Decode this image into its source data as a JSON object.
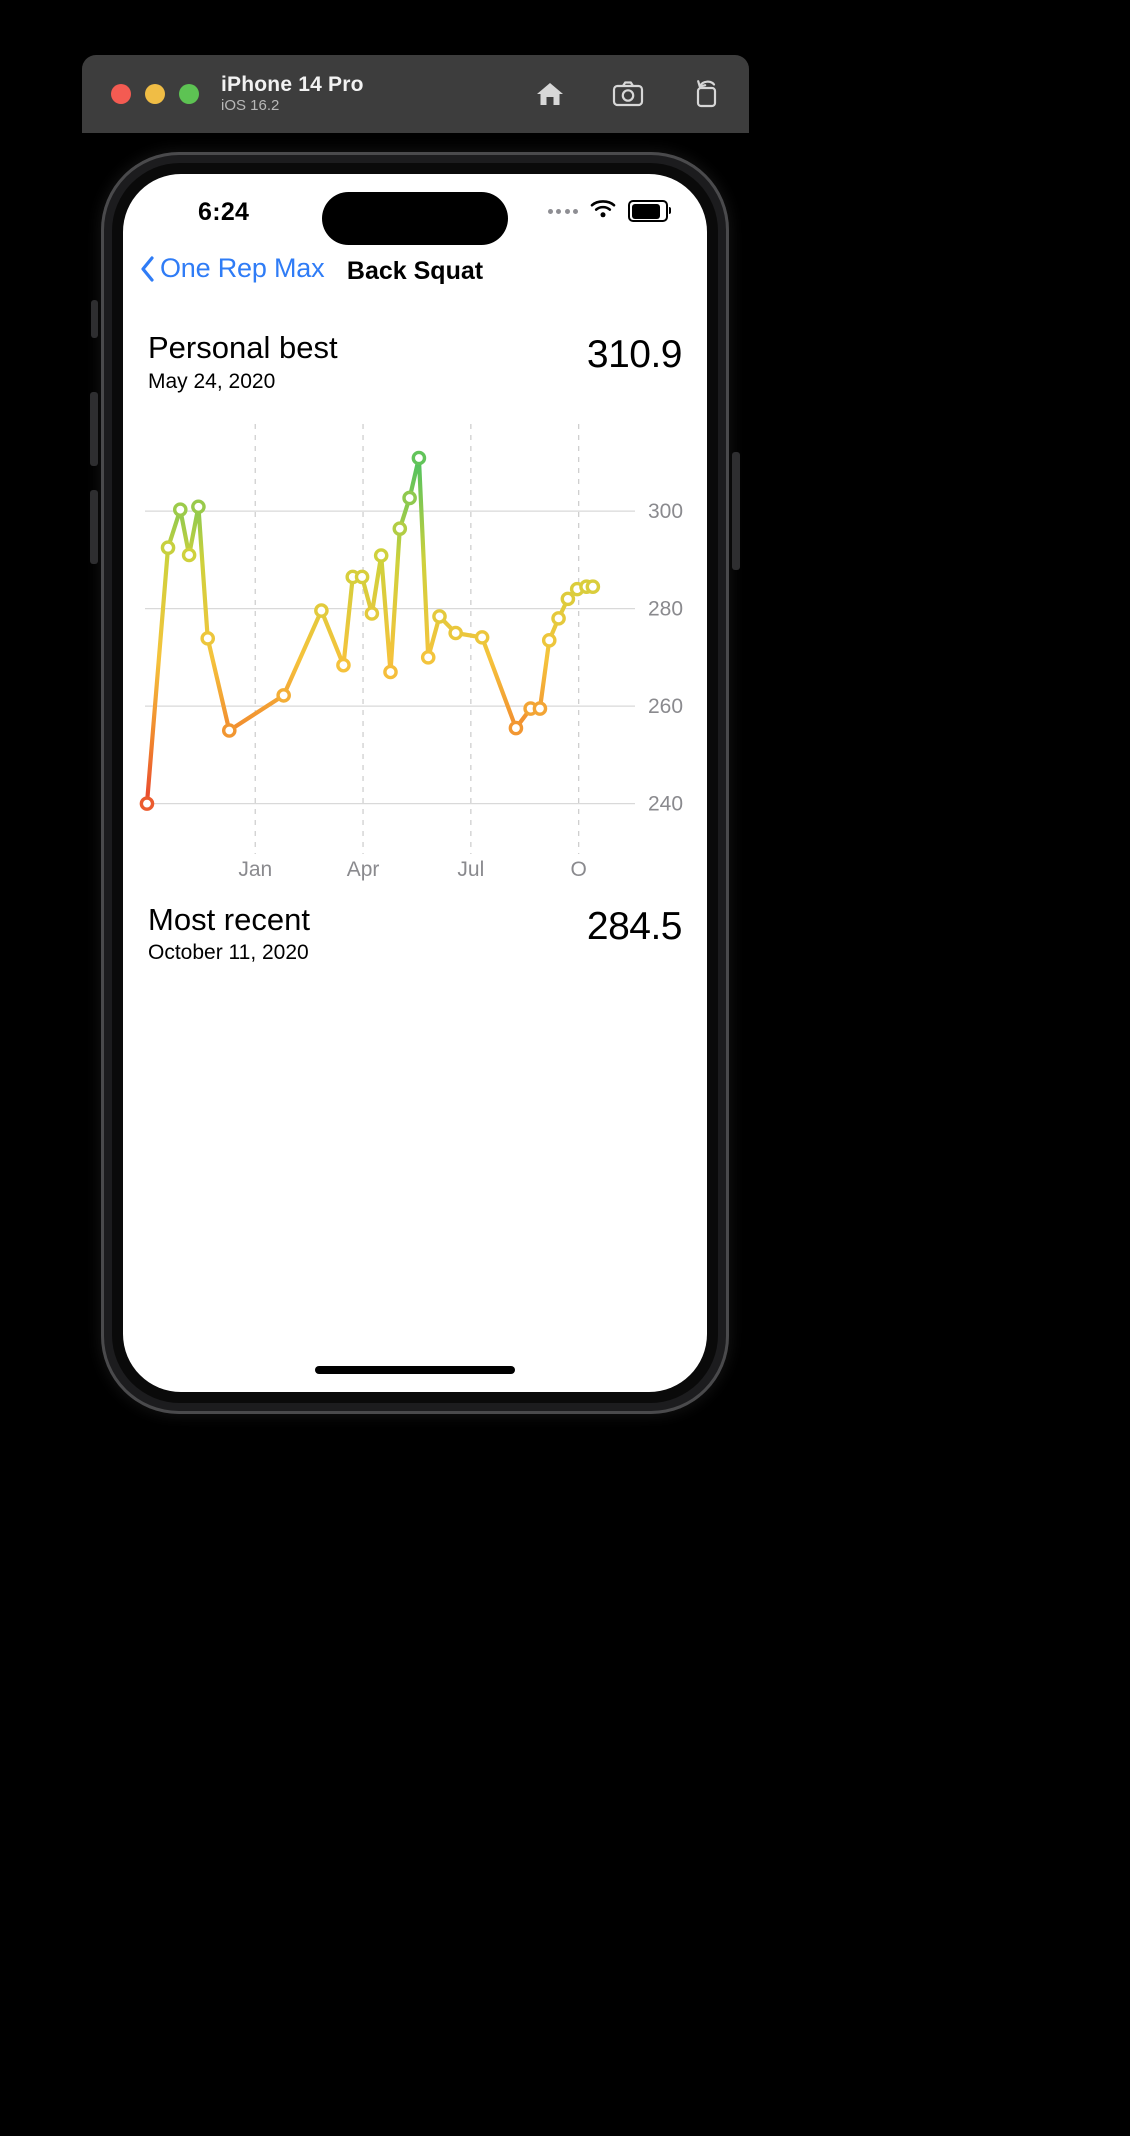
{
  "window": {
    "title": "iPhone 14 Pro",
    "subtitle": "iOS 16.2",
    "traffic_lights": [
      "close-red",
      "minimize-yellow",
      "zoom-green"
    ],
    "actions": [
      {
        "name": "home-icon",
        "label": "Home"
      },
      {
        "name": "screenshot-icon",
        "label": "Screenshot"
      },
      {
        "name": "rotate-icon",
        "label": "Rotate"
      }
    ],
    "colors": {
      "chrome": "#3d3d3d",
      "red": "#f45b52",
      "yellow": "#f0bd45",
      "green": "#5dc353"
    }
  },
  "status_bar": {
    "time": "6:24",
    "cellular": "cellular-dots-icon",
    "wifi": "wifi-icon",
    "battery": "battery-icon"
  },
  "nav": {
    "back_label": "One Rep Max",
    "title": "Back Squat",
    "accent": "#2f7cf6"
  },
  "personal_best": {
    "title": "Personal best",
    "date": "May 24, 2020",
    "value": "310.9"
  },
  "most_recent": {
    "title": "Most recent",
    "date": "October 11, 2020",
    "value": "284.5"
  },
  "chart_data": {
    "type": "line",
    "title": "",
    "xlabel": "",
    "ylabel": "",
    "ylim": [
      235,
      315
    ],
    "yticks": [
      240,
      260,
      280,
      300
    ],
    "ytick_labels": [
      "240",
      "260",
      "280",
      "300"
    ],
    "xtick_labels": [
      "Jan",
      "Apr",
      "Jul",
      "O"
    ],
    "xtick_positions": [
      0.225,
      0.445,
      0.665,
      0.885
    ],
    "grid": "horizontal-solid-and-vertical-dashed",
    "gradient_stops": [
      {
        "offset": 0.0,
        "color": "#e8452f"
      },
      {
        "offset": 0.18,
        "color": "#f0832d"
      },
      {
        "offset": 0.42,
        "color": "#f5c33c"
      },
      {
        "offset": 0.7,
        "color": "#cfd13c"
      },
      {
        "offset": 1.0,
        "color": "#4cc160"
      }
    ],
    "marker": "open-circle",
    "series": [
      {
        "name": "One Rep Max",
        "x": [
          0.004,
          0.047,
          0.072,
          0.09,
          0.109,
          0.128,
          0.172,
          0.283,
          0.36,
          0.405,
          0.424,
          0.443,
          0.463,
          0.482,
          0.501,
          0.52,
          0.54,
          0.559,
          0.578,
          0.601,
          0.634,
          0.688,
          0.757,
          0.787,
          0.806,
          0.825,
          0.844,
          0.863,
          0.882,
          0.901,
          0.914
        ],
        "y": [
          240.0,
          292.5,
          300.3,
          291.0,
          300.9,
          273.9,
          255.0,
          262.2,
          279.6,
          268.4,
          286.5,
          286.5,
          279.0,
          290.9,
          267.0,
          296.4,
          302.7,
          310.9,
          270.0,
          278.4,
          275.0,
          274.1,
          255.5,
          259.5,
          259.5,
          273.5,
          278.0,
          282.0,
          284.0,
          284.5,
          284.5
        ],
        "point_count": 31
      }
    ]
  }
}
